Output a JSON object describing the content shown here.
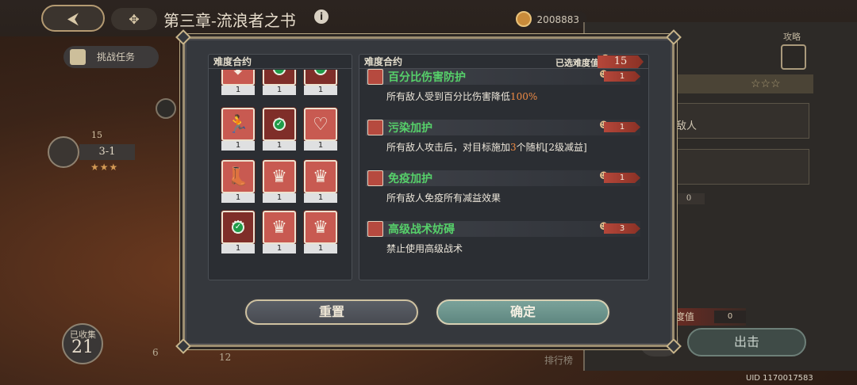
{
  "background": {
    "chapter_title": "第三章-流浪者之书",
    "info_glyph": "i",
    "gold_value": "2008883",
    "task_label": "挑战任务",
    "stage_label": "3-1",
    "stage_level": "15",
    "stars": "★★★",
    "collected_label": "已收集",
    "collected_value": "21",
    "node_values": [
      "6",
      "12"
    ],
    "right_panel": {
      "attack_label": "攻略",
      "enemy_label": "敌人",
      "counter_value": "0",
      "difficulty_label": "度值",
      "difficulty_value": "0",
      "go_button": "出击",
      "rank_label": "排行榜",
      "stars_empty": "☆☆☆"
    },
    "uid": "UID 1170017583"
  },
  "modal": {
    "left_panel_title": "难度合约",
    "right_panel_title": "难度合约",
    "selected_label": "已选难度值",
    "selected_value": "15",
    "tiles": [
      {
        "icon": "shield-down-icon",
        "count": "1",
        "checked": false,
        "dim": false
      },
      {
        "icon": "cancel-skill-icon",
        "count": "1",
        "checked": true,
        "dim": true
      },
      {
        "icon": "heart-check-icon",
        "count": "1",
        "checked": true,
        "dim": true
      },
      {
        "icon": "enemy-run-icon",
        "count": "1",
        "checked": false,
        "dim": false
      },
      {
        "icon": "star-burst-icon",
        "count": "1",
        "checked": true,
        "dim": true
      },
      {
        "icon": "heart-plus-icon",
        "count": "1",
        "checked": false,
        "dim": false
      },
      {
        "icon": "boot-up-icon",
        "count": "1",
        "checked": false,
        "dim": false
      },
      {
        "icon": "crowned-head-icon",
        "count": "1",
        "checked": false,
        "dim": false
      },
      {
        "icon": "crowned-head-icon",
        "count": "1",
        "checked": false,
        "dim": false
      },
      {
        "icon": "crowned-head-icon",
        "count": "1",
        "checked": true,
        "dim": true
      },
      {
        "icon": "crowned-head-icon",
        "count": "1",
        "checked": false,
        "dim": false
      },
      {
        "icon": "crowned-head-icon",
        "count": "1",
        "checked": false,
        "dim": false
      }
    ],
    "contracts": [
      {
        "title": "百分比伤害防护",
        "cost": "1",
        "desc_before": "所有敌人受到百分比伤害降低",
        "desc_highlight": "100%",
        "desc_after": ""
      },
      {
        "title": "污染加护",
        "cost": "1",
        "desc_before": "所有敌人攻击后，对目标施加",
        "desc_highlight": "3",
        "desc_after": "个随机[2级减益]"
      },
      {
        "title": "免疫加护",
        "cost": "1",
        "desc_before": "所有敌人免疫所有减益效果",
        "desc_highlight": "",
        "desc_after": ""
      },
      {
        "title": "高级战术妨碍",
        "cost": "3",
        "desc_before": "禁止使用高级战术",
        "desc_highlight": "",
        "desc_after": ""
      }
    ],
    "reset_label": "重置",
    "confirm_label": "确定"
  },
  "colors": {
    "tile_red": "#c85a51",
    "contract_title_green": "#56d06a",
    "highlight_orange": "#ef8b45",
    "confirm_teal": "#6f968e"
  }
}
